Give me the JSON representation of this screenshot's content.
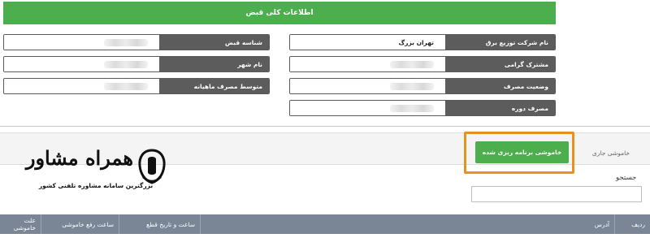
{
  "header": {
    "title": "اطلاعات کلی قبض"
  },
  "info_left": [
    {
      "label": "شناسه قبض",
      "value": ""
    },
    {
      "label": "نام شهر",
      "value": ""
    },
    {
      "label": "متوسط مصرف ماهیانه",
      "value": ""
    }
  ],
  "info_right": [
    {
      "label": "نام شرکت توزیع برق",
      "value": "تهران بزرگ"
    },
    {
      "label": "مشترک گرامی",
      "value": ""
    },
    {
      "label": "وضعیت مصرف",
      "value": ""
    },
    {
      "label": "مصرف دوره",
      "value": ""
    }
  ],
  "tabs": {
    "current": "خاموشی جاری",
    "planned": "خاموشی برنامه ریزی شده"
  },
  "watermark": {
    "brand": "همراه مشاور",
    "tagline": "بزرگترین سامانه مشاوره تلفنی کشور"
  },
  "search": {
    "label": "جستجو",
    "placeholder": ""
  },
  "table": {
    "columns": [
      "ردیف",
      "آدرس",
      "ساعت و تاریخ قطع",
      "ساعت رفع خاموشی",
      "علت خاموشی"
    ]
  },
  "colors": {
    "accent_green": "#4cae4c",
    "highlight_orange": "#e8911f",
    "label_gray": "#5c5c5c",
    "table_header": "#7a8595"
  }
}
